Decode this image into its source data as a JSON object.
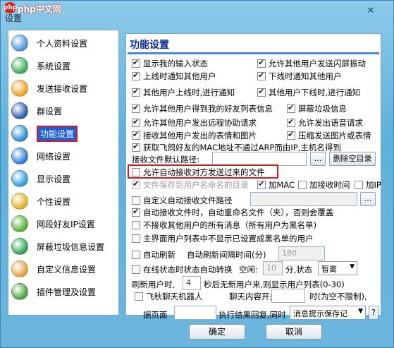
{
  "window": {
    "title": "设置",
    "watermark": "php中文网",
    "watermark_badge": "php"
  },
  "sidebar": {
    "items": [
      {
        "label": "个人资料设置",
        "icon": "person-icon",
        "color": "#4a90d8"
      },
      {
        "label": "系统设置",
        "icon": "system-icon",
        "color": "#3aa858"
      },
      {
        "label": "发送接收设置",
        "icon": "send-receive-icon",
        "color": "#f0a020"
      },
      {
        "label": "群设置",
        "icon": "group-icon",
        "color": "#2a5aa8"
      },
      {
        "label": "功能设置",
        "icon": "function-icon",
        "color": "#2a8ad0",
        "selected": true
      },
      {
        "label": "网络设置",
        "icon": "network-icon",
        "color": "#2a7ad8"
      },
      {
        "label": "显示设置",
        "icon": "display-icon",
        "color": "#2a9ad8"
      },
      {
        "label": "个性设置",
        "icon": "personalize-icon",
        "color": "#e0b020"
      },
      {
        "label": "网段好友IP设置",
        "icon": "ip-icon",
        "color": "#50b030"
      },
      {
        "label": "屏蔽垃圾信息设置",
        "icon": "block-icon",
        "color": "#30a050"
      },
      {
        "label": "自定义信息设置",
        "icon": "custom-info-icon",
        "color": "#e0a040"
      },
      {
        "label": "插件管理及设置",
        "icon": "plugin-icon",
        "color": "#4aa040"
      }
    ]
  },
  "panel": {
    "title": "功能设置",
    "options": {
      "show_input_status": "显示我的输入状态",
      "allow_flash_vibrate": "允许其他用户发送闪屏振动",
      "notify_online": "上线时通知其他用户",
      "notify_offline": "下线时通知其他用户",
      "notify_when_others_online": "其他用户上线时,进行通知",
      "notify_when_others_offline": "其他用户下线时,进行通知",
      "allow_get_friend_list": "允许其他用户得到我的好友列表信息",
      "block_spam": "屏蔽垃圾信息",
      "allow_remote_assist": "允许其他用户发出远程协助请求",
      "allow_voice_request": "允许发出语音请求",
      "receive_emoji_images": "接收其他用户发出的表情和图片",
      "compress_images": "压缩发送图片或表情",
      "get_mac_address": "获取飞鸽好友的MAC地址不通过ARP而由IP,主机名得到",
      "receive_path_label": "接收文件默认路径:",
      "receive_path_value": "",
      "browse_label": "...",
      "delete_empty_dir": "删除空目录",
      "auto_receive_files": "允许自动接收对方发送过来的文件",
      "save_to_user_dir": "文件保存到用户名命名的目录",
      "add_mac": "加MAC",
      "add_receive_time": "加接收时间",
      "add_ip": "加IP",
      "custom_receive_path": "自定义自动接收文件路径",
      "custom_path_value": "",
      "auto_rename": "自动接收文件时，自动重命名文件（夹），否则会覆盖",
      "no_receive_others": "不接收其他用户的所有消息（所有用户为黑名单)",
      "hide_blacklist_users": "主界面用户列表中不显示已设置成黑名单的用户",
      "auto_refresh": "自动刷新",
      "auto_refresh_interval_label": "自动刷新间隔时间(分)",
      "auto_refresh_interval": "180",
      "online_auto_switch": "在线状态时状态自动转换",
      "idle_label": "空闲:",
      "idle_minutes": "10",
      "status_label": "分,状态",
      "status_value": "暂离",
      "refresh_users_label": "刷新用户时,",
      "refresh_users_value": "4",
      "refresh_users_suffix": "秒后无新用户来,则显示用户列表(0-30)",
      "feiqiu_robot": "飞秋聊天机器人",
      "chat_prefix_label": "聊天内容开头为",
      "chat_prefix_value": "",
      "chat_prefix_suffix": "时(为空不限制),",
      "page_label": "据页面",
      "page_value": "",
      "exec_result_label": "执行结果回复,同时",
      "message_type": "消息提示保存记",
      "help_label": "?"
    }
  },
  "footer": {
    "ok": "确定",
    "cancel": "取消"
  }
}
